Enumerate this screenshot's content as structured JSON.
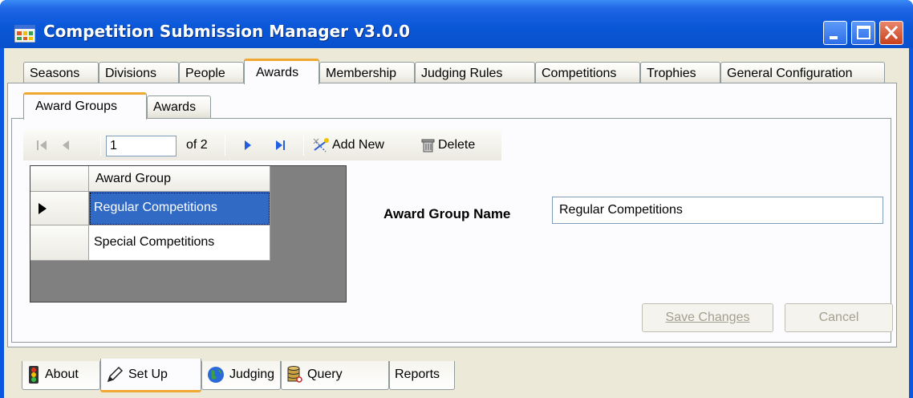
{
  "window": {
    "title": "Competition Submission Manager v3.0.0"
  },
  "main_tabs": [
    "Seasons",
    "Divisions",
    "People",
    "Awards",
    "Membership",
    "Judging Rules",
    "Competitions",
    "Trophies",
    "General Configuration"
  ],
  "selected_main_tab": "Awards",
  "sub_tabs": [
    "Award Groups",
    "Awards"
  ],
  "selected_sub_tab": "Award Groups",
  "navigator": {
    "position": "1",
    "of_label": "of 2",
    "add_new_label": "Add New",
    "delete_label": "Delete"
  },
  "grid": {
    "column_header": "Award Group",
    "rows": [
      "Regular Competitions",
      "Special Competitions"
    ],
    "selected_row": 0
  },
  "form": {
    "award_group_name_label": "Award Group Name",
    "award_group_name_value": "Regular Competitions"
  },
  "buttons": {
    "save_label": "Save Changes",
    "cancel_label": "Cancel"
  },
  "bottom_tabs": [
    "About",
    "Set Up",
    "Judging",
    "Query",
    "Reports"
  ],
  "selected_bottom_tab": "Set Up",
  "icons": {
    "app": "app-grid-icon",
    "first": "first-record-icon",
    "prev": "previous-record-icon",
    "next": "next-record-icon",
    "last": "last-record-icon",
    "add_new": "add-new-icon",
    "delete": "delete-icon",
    "about": "traffic-light-icon",
    "set_up": "pencil-icon",
    "judging": "globe-icon",
    "query": "database-icon"
  },
  "colors": {
    "titlebar": "#0a58d8",
    "selected_tab_accent": "#f0a830",
    "selected_row": "#316ac5",
    "grid_background": "#808080",
    "nav_arrow": "#1f5fe0"
  }
}
